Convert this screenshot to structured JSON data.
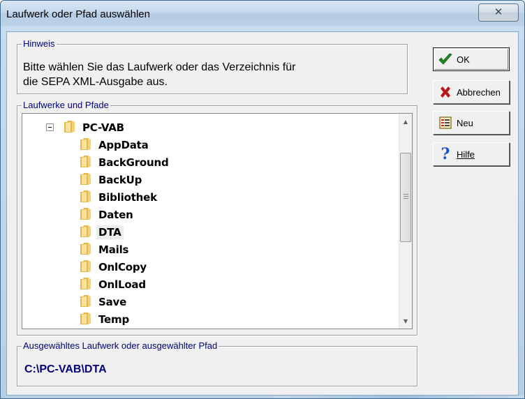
{
  "window": {
    "title": "Laufwerk oder Pfad auswählen",
    "close_glyph": "✕"
  },
  "hint": {
    "label": "Hinweis",
    "lines": [
      "Bitte wählen Sie das Laufwerk oder das Verzeichnis für",
      "die SEPA XML-Ausgabe aus."
    ]
  },
  "tree": {
    "label": "Laufwerke und Pfade",
    "root": {
      "label": "PC-VAB",
      "icon": "folder-icon",
      "expanded": true
    },
    "children": [
      {
        "label": "AppData"
      },
      {
        "label": "BackGround"
      },
      {
        "label": "BackUp"
      },
      {
        "label": "Bibliothek"
      },
      {
        "label": "Daten"
      },
      {
        "label": "DTA",
        "selected": true
      },
      {
        "label": "Mails"
      },
      {
        "label": "OnlCopy"
      },
      {
        "label": "OnlLoad"
      },
      {
        "label": "Save"
      },
      {
        "label": "Temp"
      }
    ]
  },
  "selected_path": {
    "label": "Ausgewähltes Laufwerk oder ausgewählter Pfad",
    "value": "C:\\PC-VAB\\DTA"
  },
  "buttons": {
    "ok": {
      "label": "OK",
      "icon": "checkmark-icon"
    },
    "cancel": {
      "label": "Abbrechen",
      "icon": "x-icon"
    },
    "new": {
      "label": "Neu",
      "icon": "new-folder-icon"
    },
    "help": {
      "label": "Hilfe",
      "icon": "question-icon"
    }
  },
  "colors": {
    "group_label": "#00007a",
    "ok_check": "#1f8a1f",
    "cancel_x": "#b81818",
    "help_q": "#1a55c8"
  }
}
